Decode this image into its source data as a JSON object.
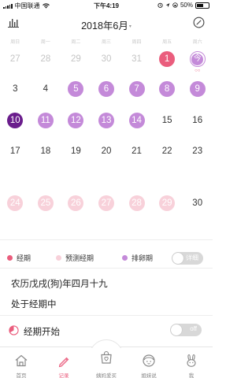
{
  "status_bar": {
    "carrier": "中国联通",
    "time": "下午4:19",
    "battery": "50%",
    "battery_level": 0.5
  },
  "header": {
    "title": "2018年6月",
    "title_caret": "▾"
  },
  "weekdays": [
    "周日",
    "周一",
    "周二",
    "周三",
    "周四",
    "周五",
    "周六"
  ],
  "calendar": {
    "days": [
      {
        "n": "27",
        "t": "other"
      },
      {
        "n": "28",
        "t": "other"
      },
      {
        "n": "29",
        "t": "other"
      },
      {
        "n": "30",
        "t": "other"
      },
      {
        "n": "31",
        "t": "other"
      },
      {
        "n": "1",
        "t": "period"
      },
      {
        "n": "今",
        "t": "today",
        "sub": "○○"
      },
      {
        "n": "3",
        "t": "normal"
      },
      {
        "n": "4",
        "t": "normal"
      },
      {
        "n": "5",
        "t": "ovul"
      },
      {
        "n": "6",
        "t": "ovul"
      },
      {
        "n": "7",
        "t": "ovul"
      },
      {
        "n": "8",
        "t": "ovul"
      },
      {
        "n": "9",
        "t": "ovul"
      },
      {
        "n": "10",
        "t": "peak"
      },
      {
        "n": "11",
        "t": "ovul"
      },
      {
        "n": "12",
        "t": "ovul"
      },
      {
        "n": "13",
        "t": "ovul"
      },
      {
        "n": "14",
        "t": "ovul"
      },
      {
        "n": "15",
        "t": "normal"
      },
      {
        "n": "16",
        "t": "normal"
      },
      {
        "n": "17",
        "t": "normal"
      },
      {
        "n": "18",
        "t": "normal"
      },
      {
        "n": "19",
        "t": "normal"
      },
      {
        "n": "20",
        "t": "normal"
      },
      {
        "n": "21",
        "t": "normal"
      },
      {
        "n": "22",
        "t": "normal"
      },
      {
        "n": "23",
        "t": "normal"
      },
      {
        "n": "24",
        "t": "pred"
      },
      {
        "n": "25",
        "t": "pred"
      },
      {
        "n": "26",
        "t": "pred"
      },
      {
        "n": "27",
        "t": "pred"
      },
      {
        "n": "28",
        "t": "pred"
      },
      {
        "n": "29",
        "t": "pred"
      },
      {
        "n": "30",
        "t": "normal"
      }
    ]
  },
  "legend": {
    "period": "经期",
    "predicted": "预测经期",
    "ovulation": "排卵期",
    "detail_toggle": "详细"
  },
  "info": {
    "lunar_date": "农历戊戌(狗)年四月十九",
    "status": "处于经期中"
  },
  "period_start": {
    "label": "经期开始",
    "toggle": "off"
  },
  "tabbar": [
    {
      "label": "首页",
      "icon": "home-icon"
    },
    {
      "label": "记录",
      "icon": "pencil-icon"
    },
    {
      "label": "姨妈爱买",
      "icon": "shopping-bag-icon"
    },
    {
      "label": "姐妹说",
      "icon": "face-icon"
    },
    {
      "label": "我",
      "icon": "bunny-icon"
    }
  ],
  "colors": {
    "period": "#ea5d7d",
    "predicted": "#f8d1da",
    "ovulation": "#c48ad9",
    "ovulation_peak": "#6a1d8c",
    "other_month_text": "#c4c4c4"
  }
}
